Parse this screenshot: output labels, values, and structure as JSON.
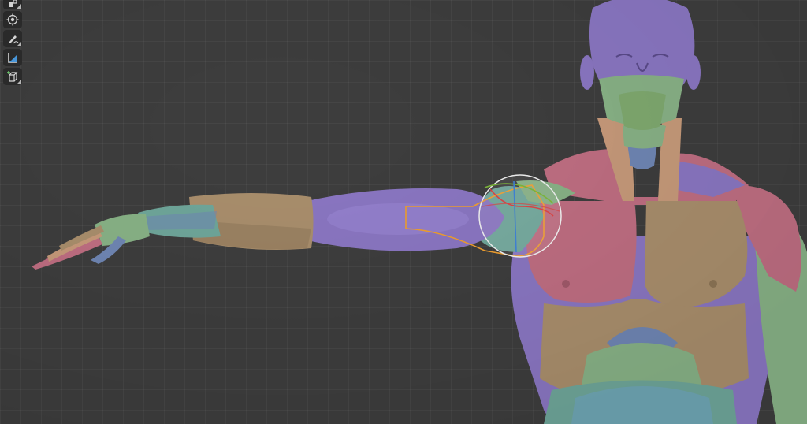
{
  "viewport": {
    "background": "#3d3d3d",
    "grid": true
  },
  "toolbar": {
    "tools": [
      {
        "icon": "scale-icon"
      },
      {
        "icon": "transform-icon"
      },
      {
        "icon": "annotate-icon"
      },
      {
        "icon": "measure-icon"
      },
      {
        "icon": "add-cube-icon"
      }
    ]
  },
  "model": {
    "colors": {
      "purple": "#8a76c2",
      "pink": "#bf6e82",
      "tan": "#a98e6c",
      "teal": "#6fa69a",
      "green": "#88b286",
      "blue": "#6f86b4"
    },
    "gizmo_colors": {
      "ring": "#e9e9e9",
      "x_axis": "#d64444",
      "y_axis": "#7ab33a",
      "z_axis": "#3f7fd0",
      "selection": "#e89a2e"
    }
  }
}
